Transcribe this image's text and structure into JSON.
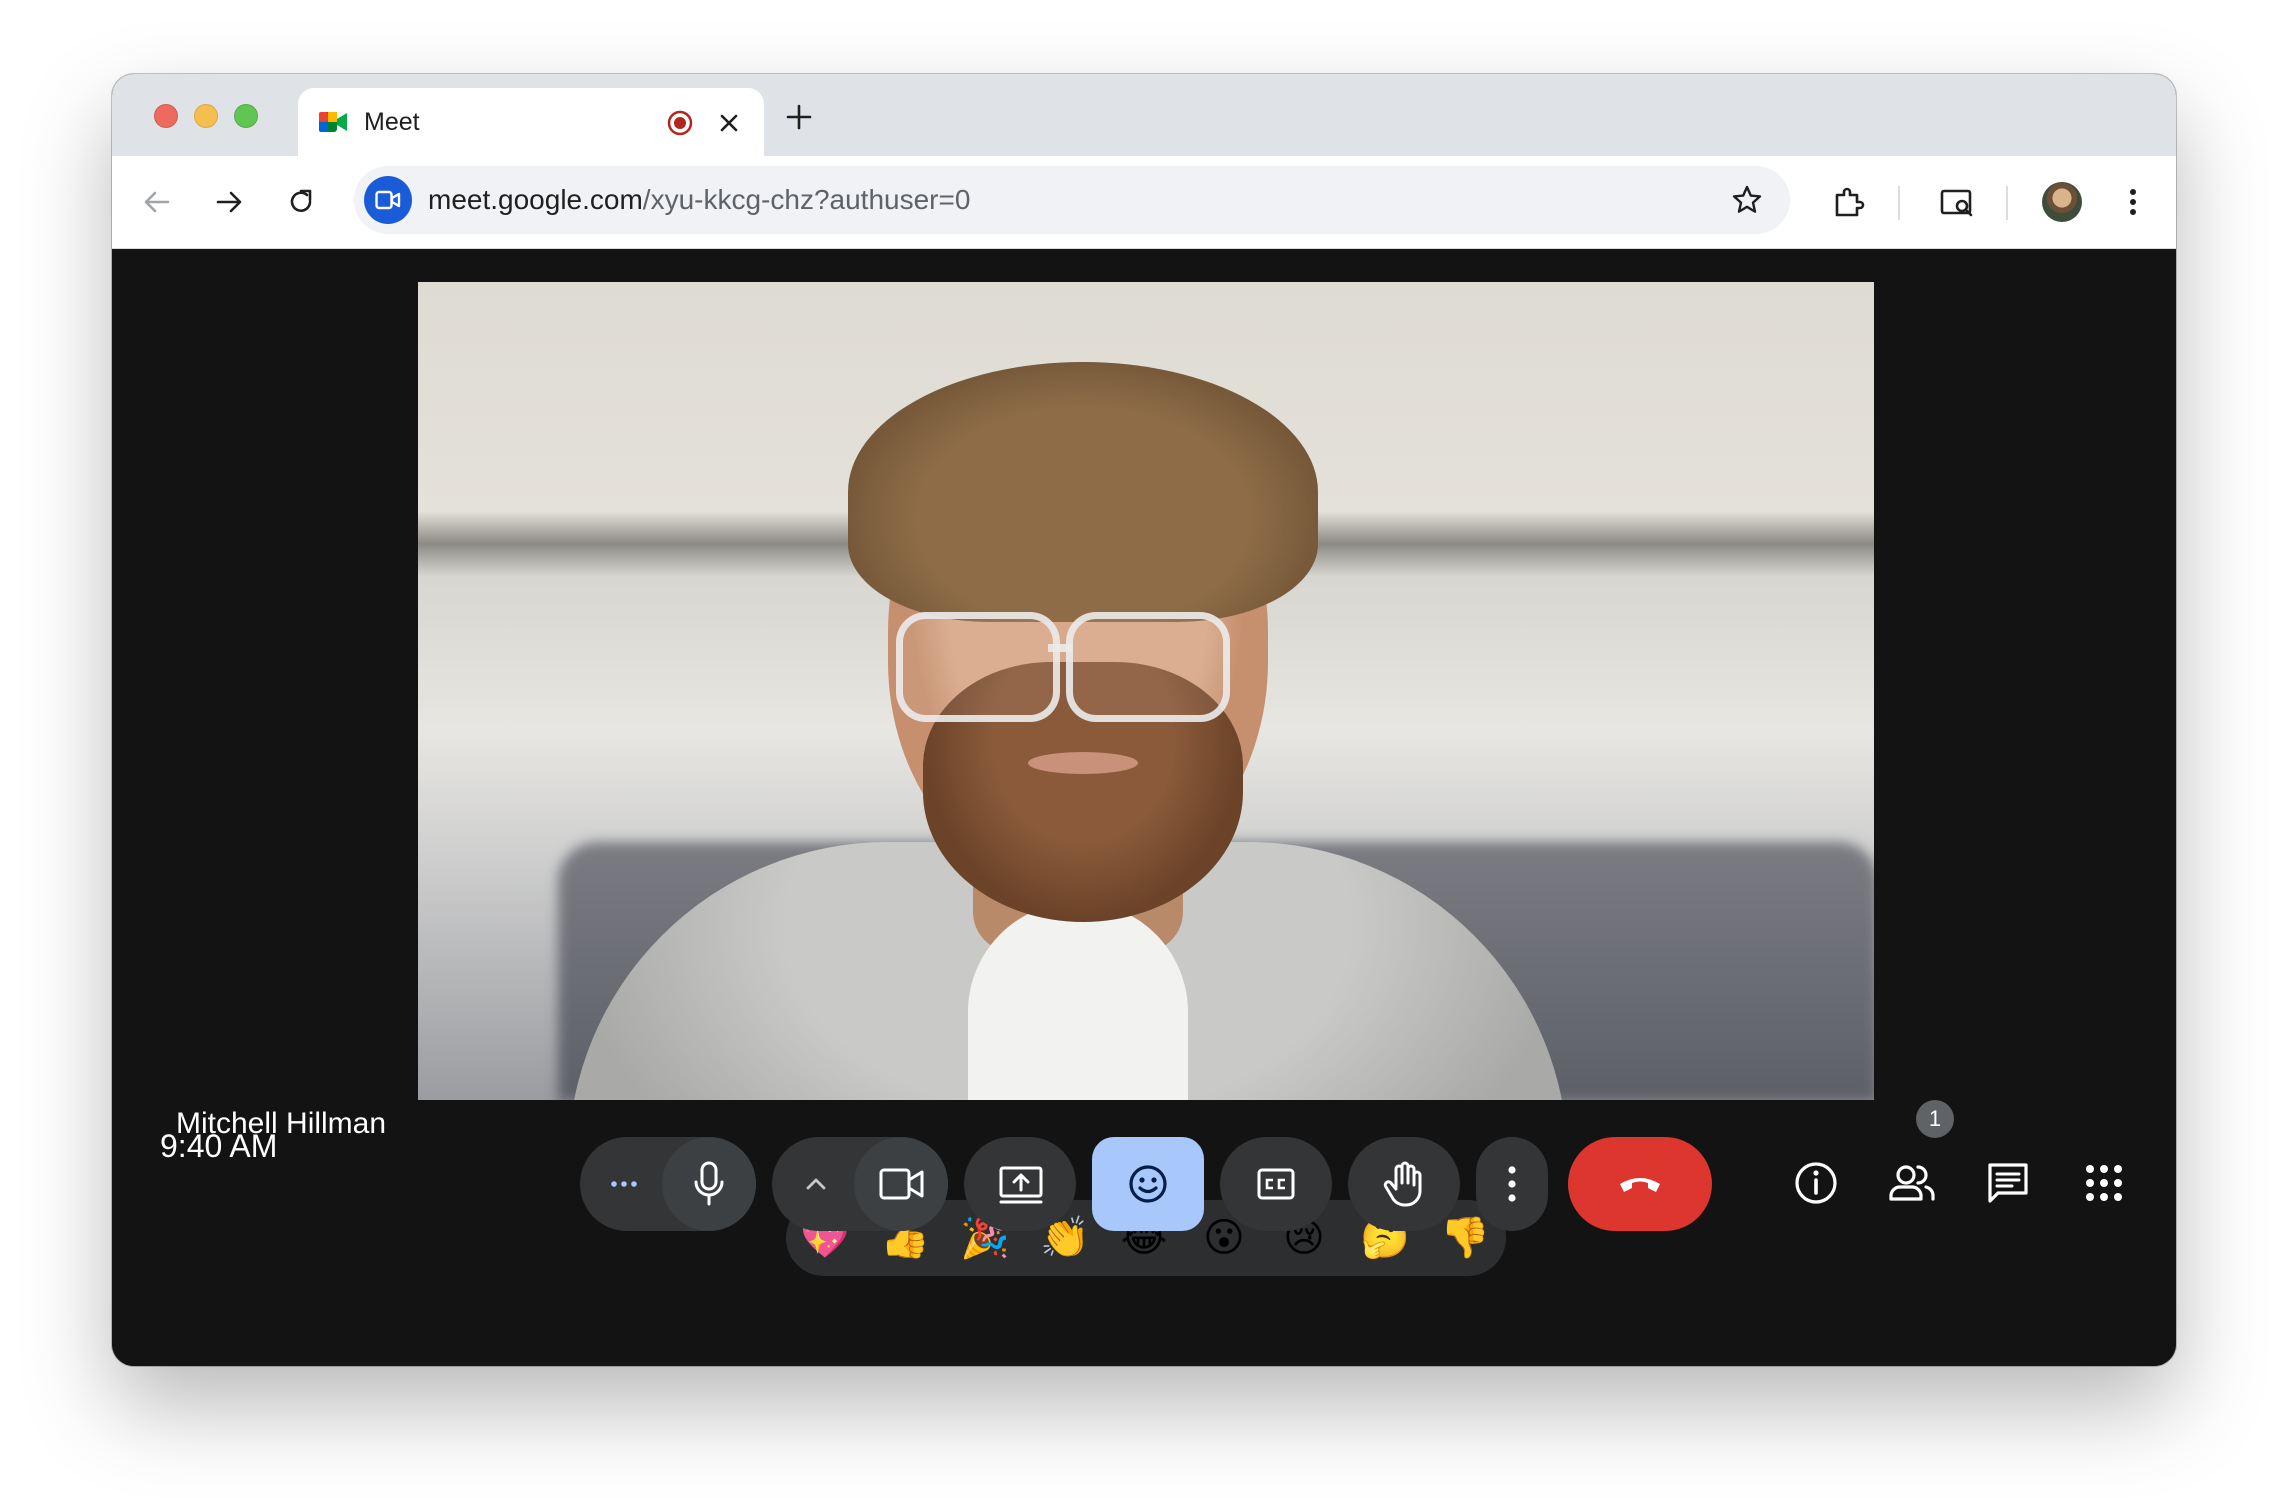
{
  "browser": {
    "tab_title": "Meet",
    "url_host": "meet.google.com",
    "url_path": "/xyu-kkcg-chz?authuser=0"
  },
  "meeting": {
    "participant_name": "Mitchell Hillman",
    "time": "9:40 AM",
    "people_count": "1"
  },
  "reactions": [
    {
      "name": "sparkling-heart",
      "glyph": "💖"
    },
    {
      "name": "thumbs-up",
      "glyph": "👍"
    },
    {
      "name": "party-popper",
      "glyph": "🎉"
    },
    {
      "name": "clapping-hands",
      "glyph": "👏"
    },
    {
      "name": "tears-of-joy",
      "glyph": "😂"
    },
    {
      "name": "surprised-face",
      "glyph": "😮"
    },
    {
      "name": "crying-face",
      "glyph": "😢"
    },
    {
      "name": "thinking-face",
      "glyph": "🤔"
    },
    {
      "name": "thumbs-down",
      "glyph": "👎"
    }
  ],
  "colors": {
    "hangup": "#dc362e",
    "reactions_active": "#a8c7fa",
    "meet_background": "#131313",
    "control_background": "#333537"
  }
}
